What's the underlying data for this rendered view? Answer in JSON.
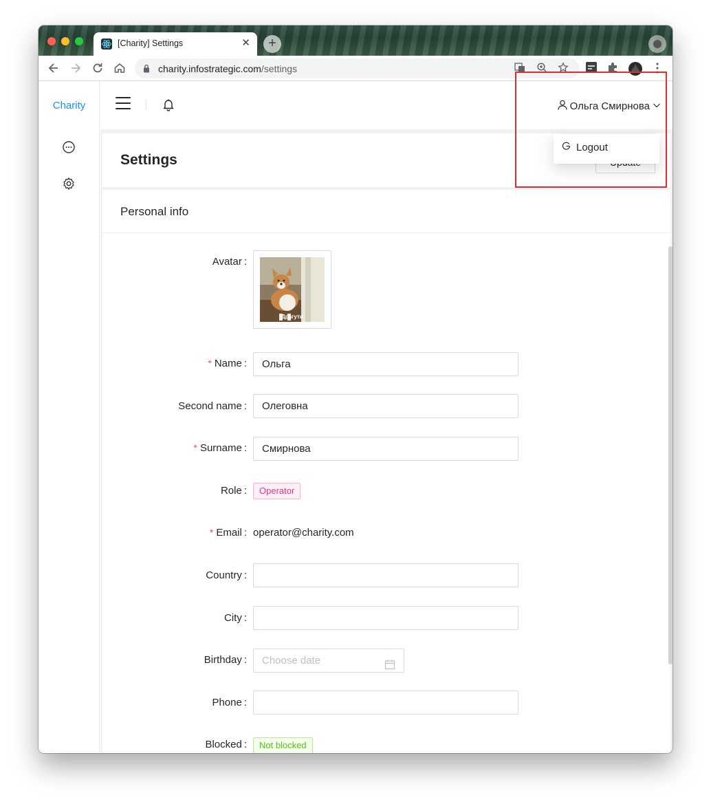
{
  "browser": {
    "tab_title": "[Charity] Settings",
    "tab_close": "✕",
    "new_tab": "+",
    "url_host": "charity.infostrategic.com",
    "url_path": "/settings"
  },
  "sidebar": {
    "brand": "Charity",
    "items": [
      {
        "icon": "message-icon"
      },
      {
        "icon": "settings-icon"
      }
    ]
  },
  "header": {
    "user_name": "Ольга Смирнова"
  },
  "dropdown": {
    "logout_label": "Logout"
  },
  "page": {
    "title": "Settings",
    "update_label": "Update"
  },
  "personal_info": {
    "title": "Personal info",
    "avatar_label": "Avatar",
    "avatar_caption": "Драгути",
    "name_label": "Name",
    "name_value": "Ольга",
    "second_name_label": "Second name",
    "second_name_value": "Олеговна",
    "surname_label": "Surname",
    "surname_value": "Смирнова",
    "role_label": "Role",
    "role_value": "Operator",
    "email_label": "Email",
    "email_value": "operator@charity.com",
    "country_label": "Country",
    "country_value": "",
    "city_label": "City",
    "city_value": "",
    "birthday_label": "Birthday",
    "birthday_placeholder": "Choose date",
    "phone_label": "Phone",
    "phone_value": "",
    "blocked_label": "Blocked",
    "blocked_value": "Not blocked"
  },
  "colors": {
    "accent": "#1890ff",
    "required": "#ff4d4f",
    "operator_tag": "#eb2f96",
    "not_blocked_tag": "#52c41a",
    "highlight": "#e52b2b"
  }
}
